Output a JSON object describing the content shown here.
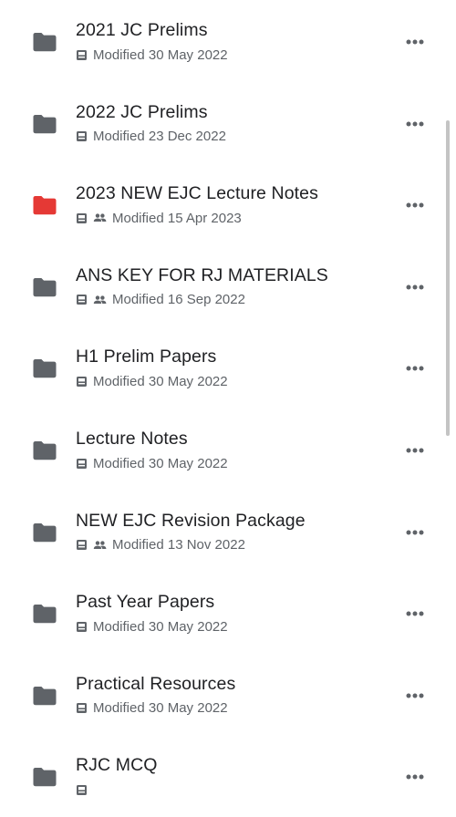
{
  "colors": {
    "folder_default": "#5f6368",
    "folder_red": "#e53935",
    "text_primary": "#202124",
    "text_secondary": "#5f6368"
  },
  "icons": {
    "folder": "folder-icon",
    "offline": "offline-icon",
    "shared": "shared-icon",
    "more": "more-options-icon"
  },
  "folders": [
    {
      "name": "2021 JC Prelims",
      "modified": "Modified 30 May 2022",
      "shared": false,
      "color": "#5f6368"
    },
    {
      "name": "2022 JC Prelims",
      "modified": "Modified 23 Dec 2022",
      "shared": false,
      "color": "#5f6368"
    },
    {
      "name": "2023 NEW EJC Lecture Notes",
      "modified": "Modified 15 Apr 2023",
      "shared": true,
      "color": "#e53935"
    },
    {
      "name": "ANS KEY FOR RJ MATERIALS",
      "modified": "Modified 16 Sep 2022",
      "shared": true,
      "color": "#5f6368"
    },
    {
      "name": "H1 Prelim Papers",
      "modified": "Modified 30 May 2022",
      "shared": false,
      "color": "#5f6368"
    },
    {
      "name": "Lecture Notes",
      "modified": "Modified 30 May 2022",
      "shared": false,
      "color": "#5f6368"
    },
    {
      "name": "NEW EJC Revision Package",
      "modified": "Modified 13 Nov 2022",
      "shared": true,
      "color": "#5f6368"
    },
    {
      "name": "Past Year Papers",
      "modified": "Modified 30 May 2022",
      "shared": false,
      "color": "#5f6368"
    },
    {
      "name": "Practical Resources",
      "modified": "Modified 30 May 2022",
      "shared": false,
      "color": "#5f6368"
    },
    {
      "name": "RJC MCQ",
      "modified": "",
      "shared": false,
      "color": "#5f6368"
    }
  ]
}
